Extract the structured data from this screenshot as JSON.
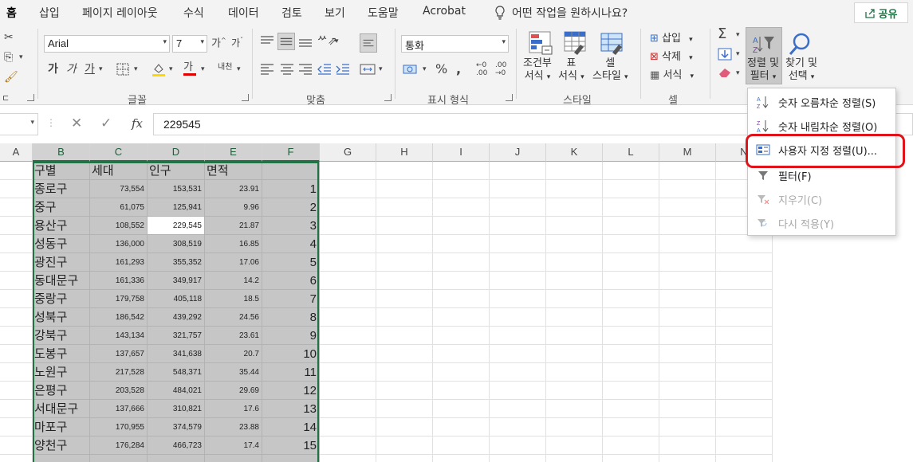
{
  "tabs": [
    "홈",
    "삽입",
    "페이지 레이아웃",
    "수식",
    "데이터",
    "검토",
    "보기",
    "도움말",
    "Acrobat"
  ],
  "tell_me": "어떤 작업을 원하시나요?",
  "share_label": "공유",
  "font": {
    "name": "Arial",
    "size": "7",
    "grow": "가",
    "shrink": "가",
    "bold": "가",
    "italic": "가",
    "underline": "가",
    "fill_color": "#ffd800",
    "font_color": "#e00000",
    "phonetic": "내천"
  },
  "number_format": "통화",
  "groups": {
    "font": "글꼴",
    "alignment": "맞춤",
    "number": "표시 형식",
    "styles": "스타일",
    "cells": "셀"
  },
  "styles": {
    "conditional": [
      "조건부",
      "서식"
    ],
    "table": [
      "표",
      "서식"
    ],
    "cell_style": [
      "셀",
      "스타일"
    ]
  },
  "cells": {
    "insert": "삽입",
    "delete": "삭제",
    "format": "서식"
  },
  "editing": {
    "sort_filter": [
      "정렬 및",
      "필터"
    ],
    "find_select": [
      "찾기 및",
      "선택"
    ]
  },
  "formula_value": "229545",
  "columns": [
    "A",
    "B",
    "C",
    "D",
    "E",
    "F",
    "G",
    "H",
    "I",
    "J",
    "K",
    "L",
    "M",
    "N"
  ],
  "headers": [
    "구별",
    "세대",
    "인구",
    "면적",
    ""
  ],
  "rows": [
    [
      "종로구",
      "73,554",
      "153,531",
      "23.91",
      "1"
    ],
    [
      "중구",
      "61,075",
      "125,941",
      "9.96",
      "2"
    ],
    [
      "용산구",
      "108,552",
      "229,545",
      "21.87",
      "3"
    ],
    [
      "성동구",
      "136,000",
      "308,519",
      "16.85",
      "4"
    ],
    [
      "광진구",
      "161,293",
      "355,352",
      "17.06",
      "5"
    ],
    [
      "동대문구",
      "161,336",
      "349,917",
      "14.2",
      "6"
    ],
    [
      "중랑구",
      "179,758",
      "405,118",
      "18.5",
      "7"
    ],
    [
      "성북구",
      "186,542",
      "439,292",
      "24.56",
      "8"
    ],
    [
      "강북구",
      "143,134",
      "321,757",
      "23.61",
      "9"
    ],
    [
      "도봉구",
      "137,657",
      "341,638",
      "20.7",
      "10"
    ],
    [
      "노원구",
      "217,528",
      "548,371",
      "35.44",
      "11"
    ],
    [
      "은평구",
      "203,528",
      "484,021",
      "29.69",
      "12"
    ],
    [
      "서대문구",
      "137,666",
      "310,821",
      "17.6",
      "13"
    ],
    [
      "마포구",
      "170,955",
      "374,579",
      "23.88",
      "14"
    ],
    [
      "양천구",
      "176,284",
      "466,723",
      "17.4",
      "15"
    ]
  ],
  "menu": [
    {
      "label": "숫자 오름차순 정렬(S)",
      "enabled": true,
      "icon": "sort-ascending-icon"
    },
    {
      "label": "숫자 내림차순 정렬(O)",
      "enabled": true,
      "icon": "sort-descending-icon"
    },
    {
      "label": "사용자 지정 정렬(U)...",
      "enabled": true,
      "icon": "custom-sort-icon"
    },
    {
      "label": "필터(F)",
      "enabled": true,
      "icon": "filter-icon"
    },
    {
      "label": "지우기(C)",
      "enabled": false,
      "icon": "clear-filter-icon"
    },
    {
      "label": "다시 적용(Y)",
      "enabled": false,
      "icon": "reapply-icon"
    }
  ],
  "colors": {
    "accent": "#217346",
    "highlight": "#e0121a",
    "selection": "#c6c6c6"
  }
}
